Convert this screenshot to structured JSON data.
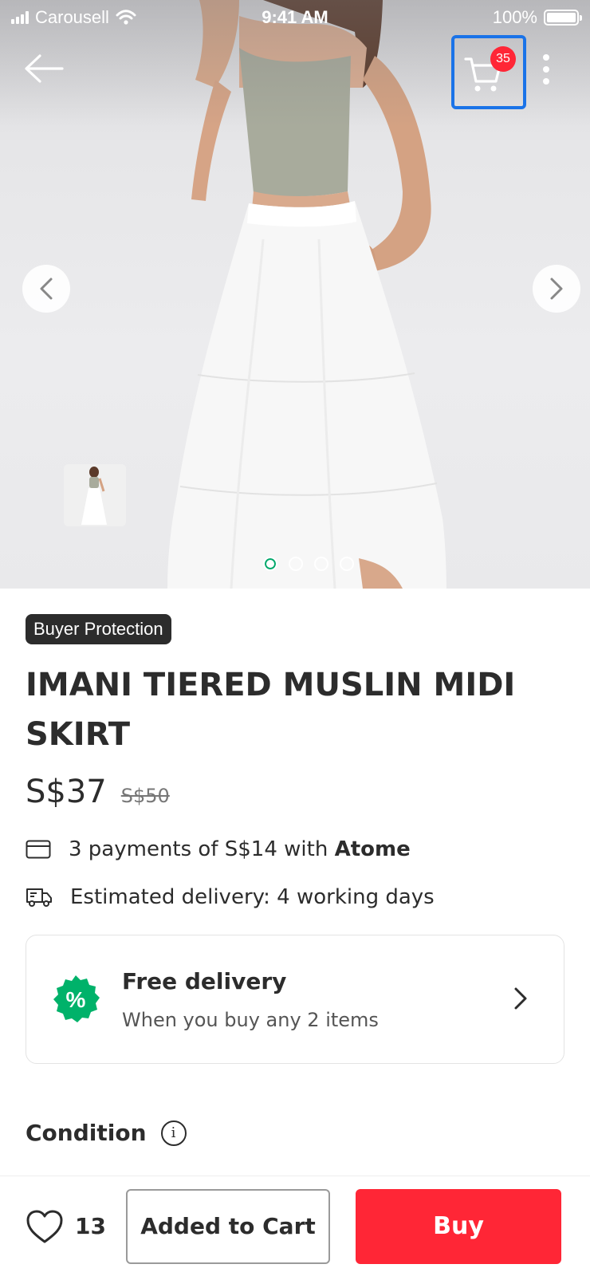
{
  "status_bar": {
    "carrier": "Carousell",
    "time": "9:41 AM",
    "battery": "100%"
  },
  "header": {
    "cart_badge": "35",
    "back_icon": "arrow-left-icon",
    "cart_icon": "cart-icon",
    "more_icon": "more-vertical-icon"
  },
  "gallery": {
    "image_count": 4,
    "active_index": 0,
    "prev_icon": "chevron-left-icon",
    "next_icon": "chevron-right-icon"
  },
  "product": {
    "badge": "Buyer Protection",
    "title": "IMANI TIERED MUSLIN MIDI SKIRT",
    "price": "S$37",
    "original_price": "S$50"
  },
  "installments": {
    "icon": "credit-card-icon",
    "text": "3 payments of S$14 with ",
    "provider": "Atome"
  },
  "delivery": {
    "icon": "delivery-truck-icon",
    "text": "Estimated delivery: 4 working days"
  },
  "promo": {
    "icon": "discount-badge-icon",
    "title": "Free delivery",
    "subtitle": "When you buy any 2 items"
  },
  "condition": {
    "label": "Condition",
    "icon": "info-icon"
  },
  "bottom_bar": {
    "like_count": "13",
    "cart_label": "Added to Cart",
    "buy_label": "Buy"
  },
  "colors": {
    "accent_red": "#ff2636",
    "promo_green": "#00b26a",
    "dark_text": "#2c2c2c",
    "highlight_blue": "#1a73e8"
  }
}
